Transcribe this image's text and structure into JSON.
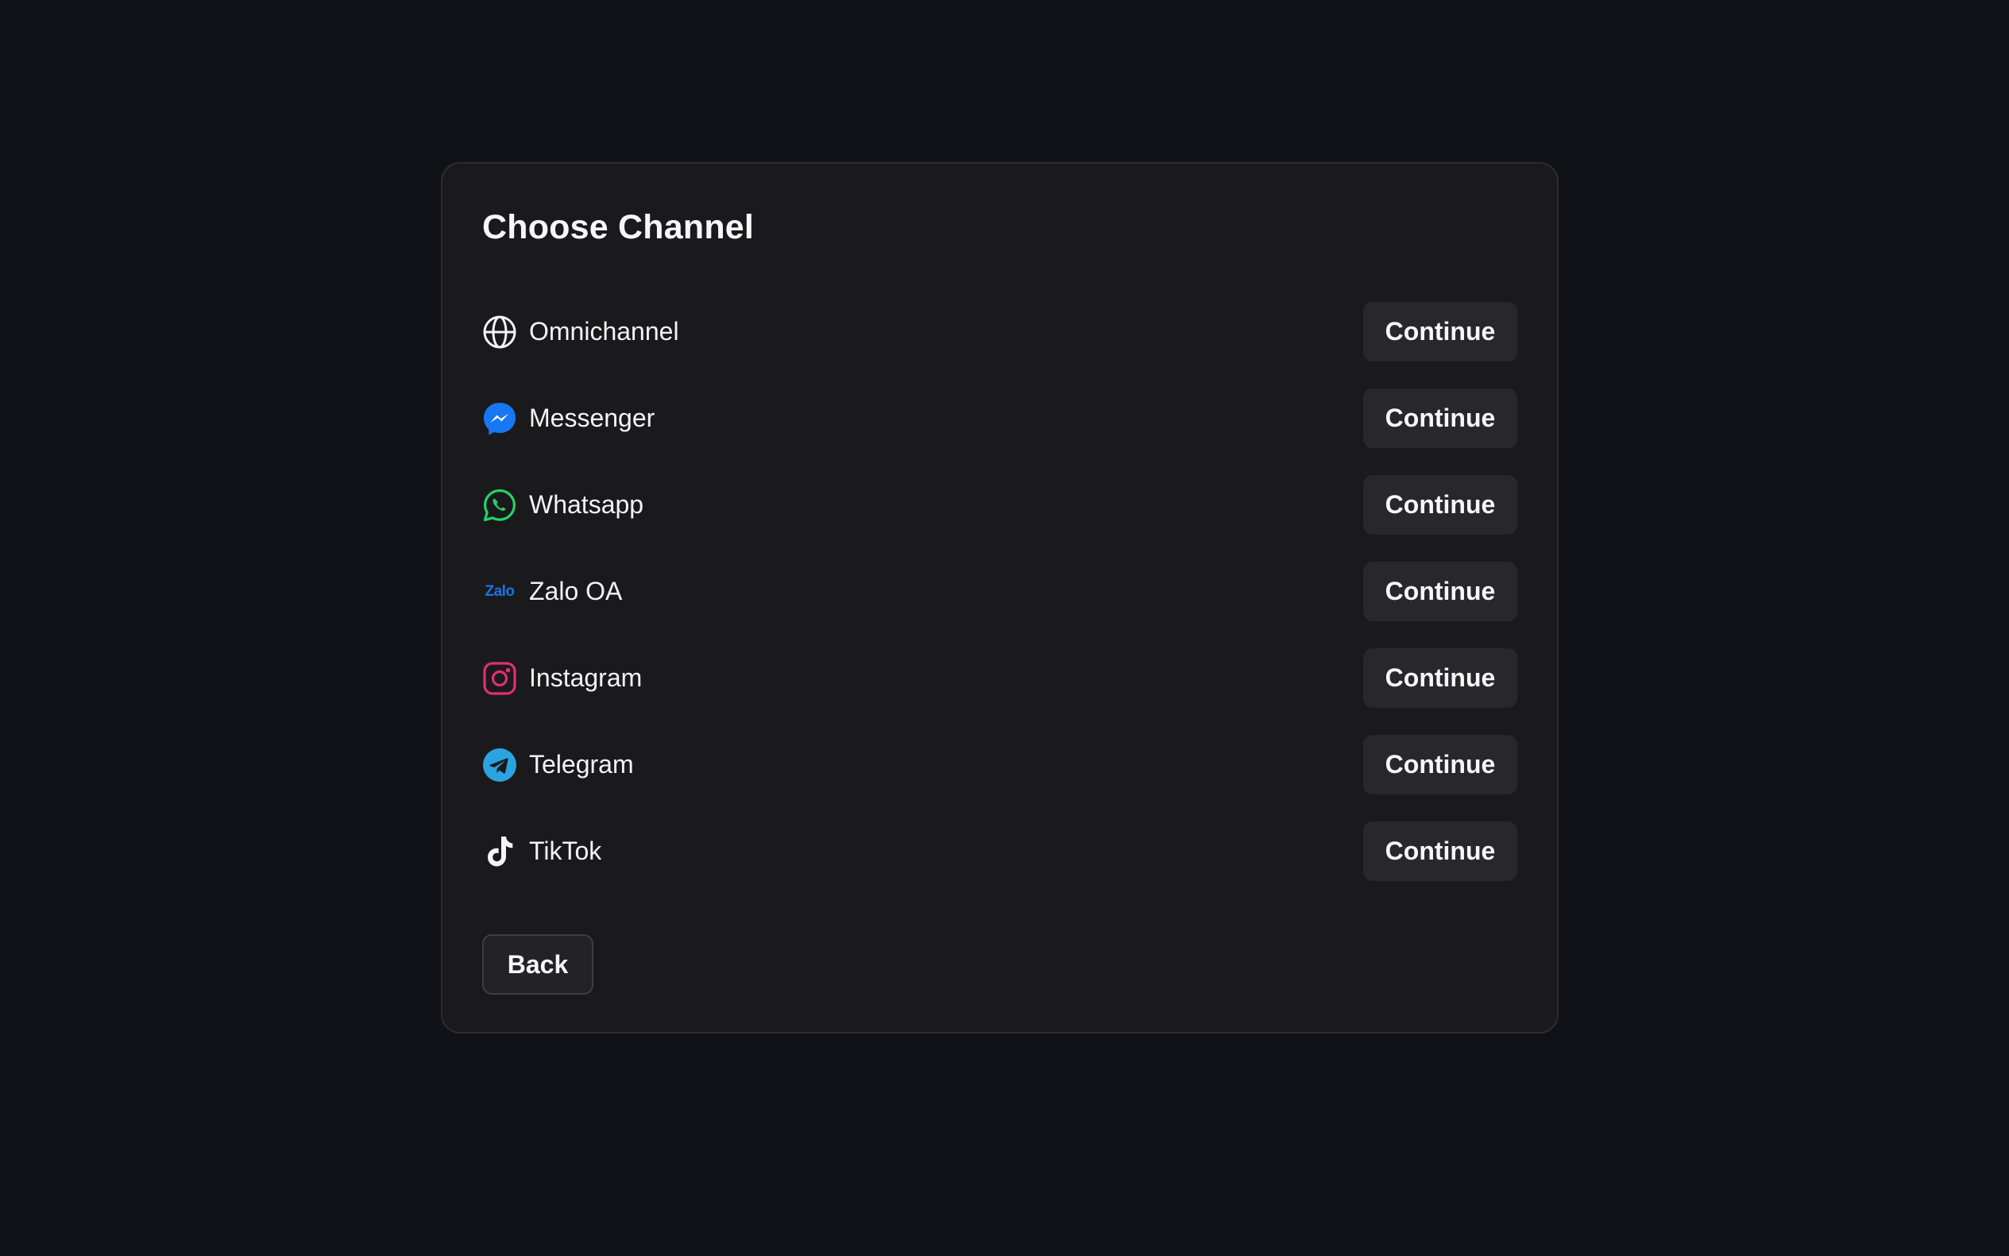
{
  "dialog": {
    "title": "Choose Channel",
    "back_label": "Back"
  },
  "channels": [
    {
      "label": "Omnichannel",
      "icon": "globe-icon",
      "button_label": "Continue"
    },
    {
      "label": "Messenger",
      "icon": "messenger-icon",
      "button_label": "Continue",
      "color": "#1877f2"
    },
    {
      "label": "Whatsapp",
      "icon": "whatsapp-icon",
      "button_label": "Continue",
      "color": "#25d366"
    },
    {
      "label": "Zalo OA",
      "icon": "zalo-icon",
      "icon_text": "Zalo",
      "button_label": "Continue",
      "color": "#1a73e8"
    },
    {
      "label": "Instagram",
      "icon": "instagram-icon",
      "button_label": "Continue",
      "color": "#e1306c"
    },
    {
      "label": "Telegram",
      "icon": "telegram-icon",
      "button_label": "Continue",
      "color": "#2aa4e0"
    },
    {
      "label": "TikTok",
      "icon": "tiktok-icon",
      "button_label": "Continue"
    }
  ],
  "colors": {
    "background": "#111217",
    "card": "#1a1a1d",
    "button": "#28282c"
  }
}
